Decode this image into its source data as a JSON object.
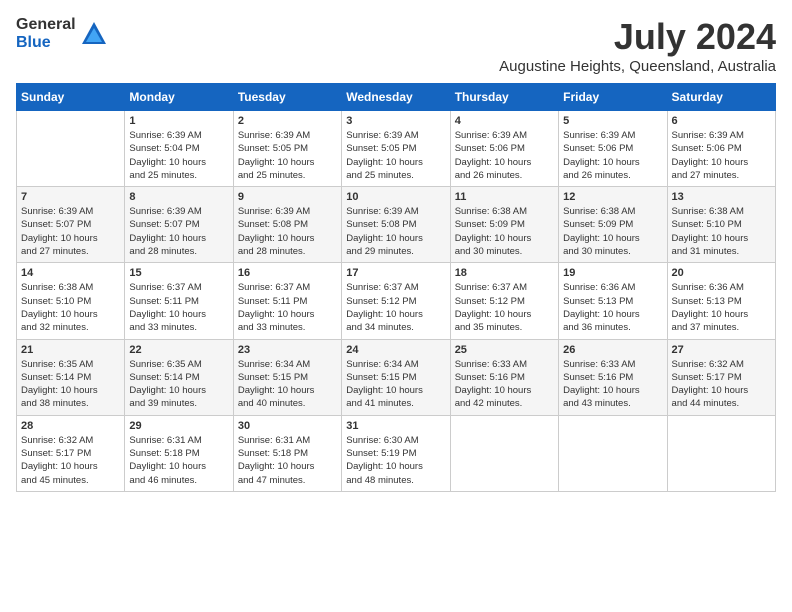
{
  "logo": {
    "general": "General",
    "blue": "Blue"
  },
  "title": "July 2024",
  "location": "Augustine Heights, Queensland, Australia",
  "days_header": [
    "Sunday",
    "Monday",
    "Tuesday",
    "Wednesday",
    "Thursday",
    "Friday",
    "Saturday"
  ],
  "weeks": [
    [
      {
        "day": "",
        "info": ""
      },
      {
        "day": "1",
        "info": "Sunrise: 6:39 AM\nSunset: 5:04 PM\nDaylight: 10 hours\nand 25 minutes."
      },
      {
        "day": "2",
        "info": "Sunrise: 6:39 AM\nSunset: 5:05 PM\nDaylight: 10 hours\nand 25 minutes."
      },
      {
        "day": "3",
        "info": "Sunrise: 6:39 AM\nSunset: 5:05 PM\nDaylight: 10 hours\nand 25 minutes."
      },
      {
        "day": "4",
        "info": "Sunrise: 6:39 AM\nSunset: 5:06 PM\nDaylight: 10 hours\nand 26 minutes."
      },
      {
        "day": "5",
        "info": "Sunrise: 6:39 AM\nSunset: 5:06 PM\nDaylight: 10 hours\nand 26 minutes."
      },
      {
        "day": "6",
        "info": "Sunrise: 6:39 AM\nSunset: 5:06 PM\nDaylight: 10 hours\nand 27 minutes."
      }
    ],
    [
      {
        "day": "7",
        "info": "Sunrise: 6:39 AM\nSunset: 5:07 PM\nDaylight: 10 hours\nand 27 minutes."
      },
      {
        "day": "8",
        "info": "Sunrise: 6:39 AM\nSunset: 5:07 PM\nDaylight: 10 hours\nand 28 minutes."
      },
      {
        "day": "9",
        "info": "Sunrise: 6:39 AM\nSunset: 5:08 PM\nDaylight: 10 hours\nand 28 minutes."
      },
      {
        "day": "10",
        "info": "Sunrise: 6:39 AM\nSunset: 5:08 PM\nDaylight: 10 hours\nand 29 minutes."
      },
      {
        "day": "11",
        "info": "Sunrise: 6:38 AM\nSunset: 5:09 PM\nDaylight: 10 hours\nand 30 minutes."
      },
      {
        "day": "12",
        "info": "Sunrise: 6:38 AM\nSunset: 5:09 PM\nDaylight: 10 hours\nand 30 minutes."
      },
      {
        "day": "13",
        "info": "Sunrise: 6:38 AM\nSunset: 5:10 PM\nDaylight: 10 hours\nand 31 minutes."
      }
    ],
    [
      {
        "day": "14",
        "info": "Sunrise: 6:38 AM\nSunset: 5:10 PM\nDaylight: 10 hours\nand 32 minutes."
      },
      {
        "day": "15",
        "info": "Sunrise: 6:37 AM\nSunset: 5:11 PM\nDaylight: 10 hours\nand 33 minutes."
      },
      {
        "day": "16",
        "info": "Sunrise: 6:37 AM\nSunset: 5:11 PM\nDaylight: 10 hours\nand 33 minutes."
      },
      {
        "day": "17",
        "info": "Sunrise: 6:37 AM\nSunset: 5:12 PM\nDaylight: 10 hours\nand 34 minutes."
      },
      {
        "day": "18",
        "info": "Sunrise: 6:37 AM\nSunset: 5:12 PM\nDaylight: 10 hours\nand 35 minutes."
      },
      {
        "day": "19",
        "info": "Sunrise: 6:36 AM\nSunset: 5:13 PM\nDaylight: 10 hours\nand 36 minutes."
      },
      {
        "day": "20",
        "info": "Sunrise: 6:36 AM\nSunset: 5:13 PM\nDaylight: 10 hours\nand 37 minutes."
      }
    ],
    [
      {
        "day": "21",
        "info": "Sunrise: 6:35 AM\nSunset: 5:14 PM\nDaylight: 10 hours\nand 38 minutes."
      },
      {
        "day": "22",
        "info": "Sunrise: 6:35 AM\nSunset: 5:14 PM\nDaylight: 10 hours\nand 39 minutes."
      },
      {
        "day": "23",
        "info": "Sunrise: 6:34 AM\nSunset: 5:15 PM\nDaylight: 10 hours\nand 40 minutes."
      },
      {
        "day": "24",
        "info": "Sunrise: 6:34 AM\nSunset: 5:15 PM\nDaylight: 10 hours\nand 41 minutes."
      },
      {
        "day": "25",
        "info": "Sunrise: 6:33 AM\nSunset: 5:16 PM\nDaylight: 10 hours\nand 42 minutes."
      },
      {
        "day": "26",
        "info": "Sunrise: 6:33 AM\nSunset: 5:16 PM\nDaylight: 10 hours\nand 43 minutes."
      },
      {
        "day": "27",
        "info": "Sunrise: 6:32 AM\nSunset: 5:17 PM\nDaylight: 10 hours\nand 44 minutes."
      }
    ],
    [
      {
        "day": "28",
        "info": "Sunrise: 6:32 AM\nSunset: 5:17 PM\nDaylight: 10 hours\nand 45 minutes."
      },
      {
        "day": "29",
        "info": "Sunrise: 6:31 AM\nSunset: 5:18 PM\nDaylight: 10 hours\nand 46 minutes."
      },
      {
        "day": "30",
        "info": "Sunrise: 6:31 AM\nSunset: 5:18 PM\nDaylight: 10 hours\nand 47 minutes."
      },
      {
        "day": "31",
        "info": "Sunrise: 6:30 AM\nSunset: 5:19 PM\nDaylight: 10 hours\nand 48 minutes."
      },
      {
        "day": "",
        "info": ""
      },
      {
        "day": "",
        "info": ""
      },
      {
        "day": "",
        "info": ""
      }
    ]
  ]
}
